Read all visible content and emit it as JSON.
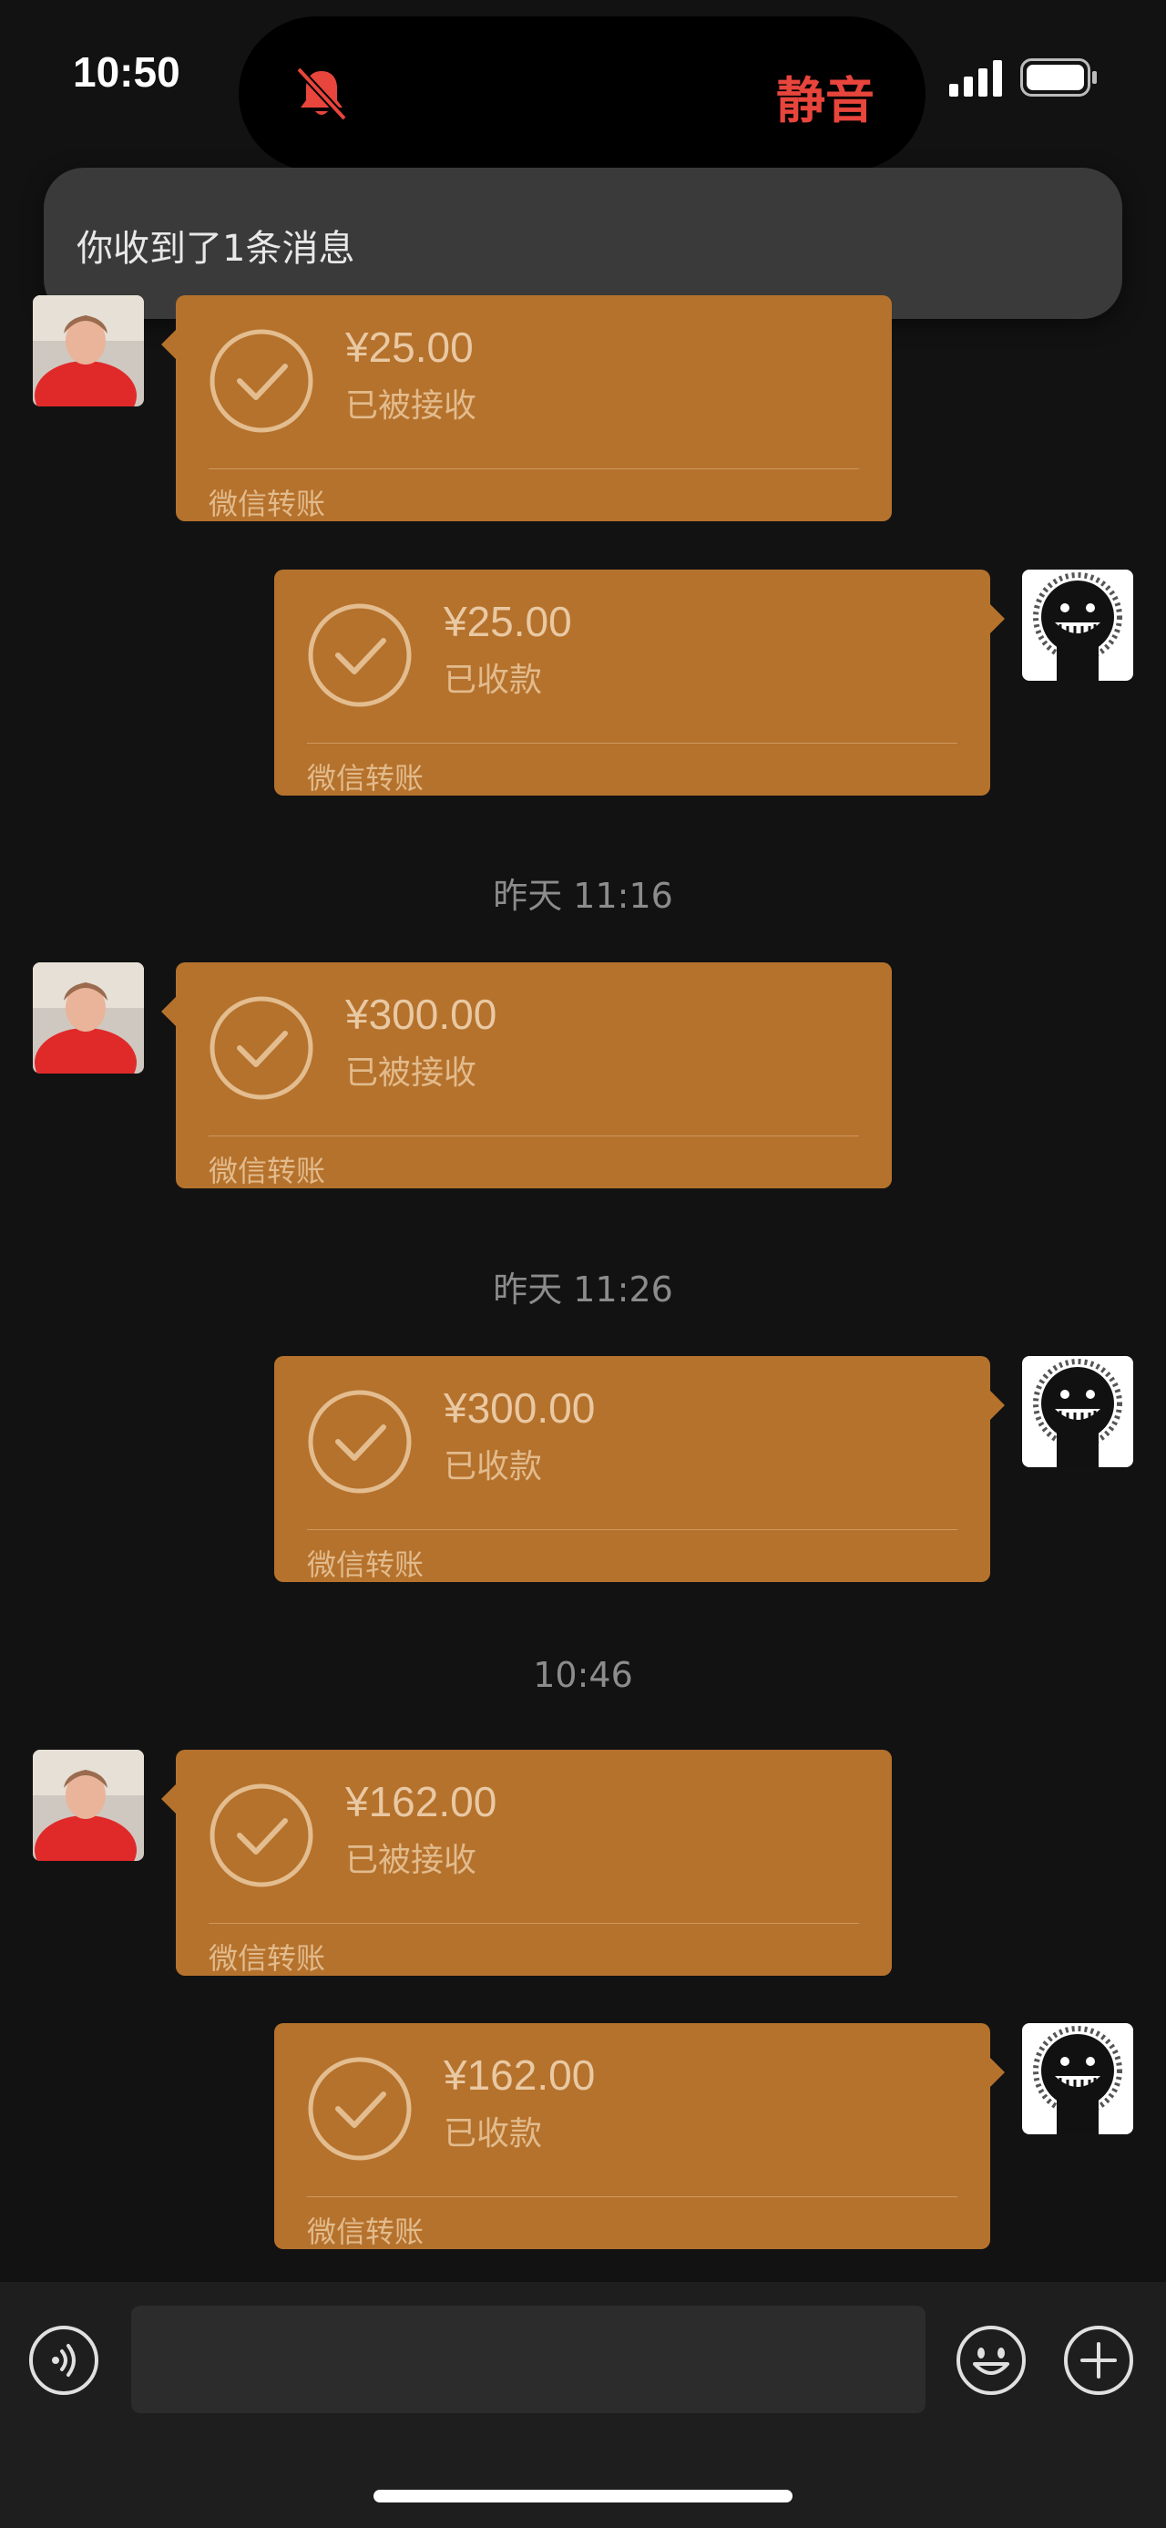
{
  "status_bar": {
    "time": "10:50",
    "silent_label": "静音",
    "bell_icon": "bell-slash-icon",
    "signal_icon": "cellular-signal-icon",
    "battery_icon": "battery-icon"
  },
  "notification": {
    "text": "你收到了1条消息"
  },
  "chat": {
    "messages": [
      {
        "side": "left",
        "amount": "¥25.00",
        "status": "已被接收",
        "footer": "微信转账"
      },
      {
        "side": "right",
        "amount": "¥25.00",
        "status": "已收款",
        "footer": "微信转账"
      },
      {
        "timestamp": "昨天 11:16"
      },
      {
        "side": "left",
        "amount": "¥300.00",
        "status": "已被接收",
        "footer": "微信转账"
      },
      {
        "timestamp": "昨天 11:26"
      },
      {
        "side": "right",
        "amount": "¥300.00",
        "status": "已收款",
        "footer": "微信转账"
      },
      {
        "timestamp": "10:46"
      },
      {
        "side": "left",
        "amount": "¥162.00",
        "status": "已被接收",
        "footer": "微信转账"
      },
      {
        "side": "right",
        "amount": "¥162.00",
        "status": "已收款",
        "footer": "微信转账"
      }
    ]
  },
  "input_bar": {
    "voice_icon": "voice-icon",
    "input_value": "",
    "emoji_icon": "emoji-icon",
    "plus_icon": "plus-icon"
  },
  "colors": {
    "background": "#121212",
    "bubble": "#b5722d",
    "bubble_text": "#e9c9a3",
    "silent_red": "#e8453c",
    "timestamp": "#8c8c8c"
  }
}
